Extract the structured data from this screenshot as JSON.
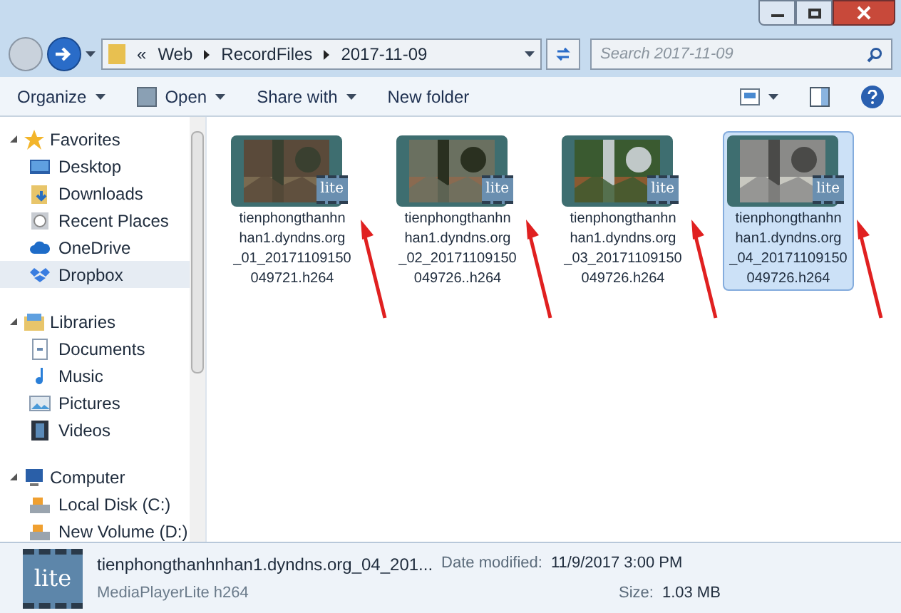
{
  "address": {
    "overflow": "«",
    "crumbs": [
      "Web",
      "RecordFiles",
      "2017-11-09"
    ]
  },
  "search": {
    "placeholder": "Search 2017-11-09"
  },
  "toolbar": [
    {
      "label": "Organize",
      "kind": "menu"
    },
    {
      "label": "Open",
      "kind": "split"
    },
    {
      "label": "Share with",
      "kind": "menu"
    },
    {
      "label": "New folder",
      "kind": "button"
    }
  ],
  "nav": [
    {
      "label": "Favorites",
      "expanded": true,
      "children": [
        {
          "label": "Desktop",
          "selected": false
        },
        {
          "label": "Downloads",
          "selected": false
        },
        {
          "label": "Recent Places",
          "selected": false
        },
        {
          "label": "OneDrive",
          "selected": false
        },
        {
          "label": "Dropbox",
          "selected": true
        }
      ]
    },
    {
      "label": "Libraries",
      "expanded": true,
      "children": [
        {
          "label": "Documents",
          "selected": false
        },
        {
          "label": "Music",
          "selected": false
        },
        {
          "label": "Pictures",
          "selected": false
        },
        {
          "label": "Videos",
          "selected": false
        }
      ]
    },
    {
      "label": "Computer",
      "expanded": true,
      "children": [
        {
          "label": "Local Disk (C:)",
          "selected": false
        },
        {
          "label": "New Volume (D:)",
          "selected": false
        }
      ]
    }
  ],
  "files": [
    {
      "name_lines": [
        "tienphongthanhn",
        "han1.dyndns.org",
        "_01_20171109150",
        "049721.h264"
      ],
      "badge": "lite",
      "selected": false
    },
    {
      "name_lines": [
        "tienphongthanhn",
        "han1.dyndns.org",
        "_02_20171109150",
        "049726..h264"
      ],
      "badge": "lite",
      "selected": false
    },
    {
      "name_lines": [
        "tienphongthanhn",
        "han1.dyndns.org",
        "_03_20171109150",
        "049726.h264"
      ],
      "badge": "lite",
      "selected": false
    },
    {
      "name_lines": [
        "tienphongthanhn",
        "han1.dyndns.org",
        "_04_20171109150",
        "049726.h264"
      ],
      "badge": "lite",
      "selected": true
    }
  ],
  "details": {
    "badge": "lite",
    "name": "tienphongthanhnhan1.dyndns.org_04_201...",
    "type": "MediaPlayerLite h264",
    "date_label": "Date modified:",
    "date_value": "11/9/2017 3:00 PM",
    "size_label": "Size:",
    "size_value": "1.03 MB"
  }
}
